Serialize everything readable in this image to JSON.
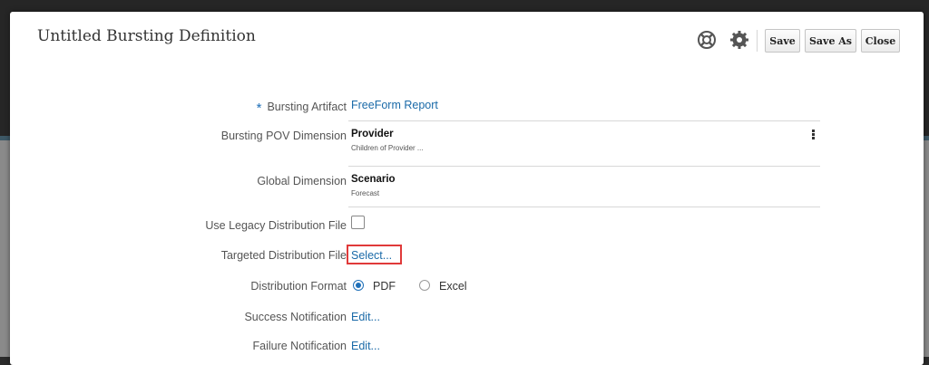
{
  "dialog": {
    "title": "Untitled Bursting Definition",
    "toolbar": {
      "help_icon": "lifebuoy-icon",
      "settings_icon": "gear-icon",
      "save_label": "Save",
      "save_as_label": "Save As",
      "close_label": "Close"
    }
  },
  "form": {
    "required_marker": "*",
    "bursting_artifact": {
      "label": "Bursting Artifact",
      "value": "FreeForm Report"
    },
    "bursting_pov_dimension": {
      "label": "Bursting POV Dimension",
      "name": "Provider",
      "detail": "Children of Provider ..."
    },
    "global_dimension": {
      "label": "Global Dimension",
      "name": "Scenario",
      "detail": "Forecast"
    },
    "use_legacy_distribution_file": {
      "label": "Use Legacy Distribution File",
      "checked": false
    },
    "targeted_distribution_file": {
      "label": "Targeted Distribution File",
      "link": "Select..."
    },
    "distribution_format": {
      "label": "Distribution Format",
      "options": [
        "PDF",
        "Excel"
      ],
      "selected": "PDF"
    },
    "success_notification": {
      "label": "Success Notification",
      "link": "Edit..."
    },
    "failure_notification": {
      "label": "Failure Notification",
      "link": "Edit..."
    }
  },
  "colors": {
    "accent": "#1e6fb8",
    "link": "#1a6aa8",
    "highlight": "#e03a3a"
  }
}
